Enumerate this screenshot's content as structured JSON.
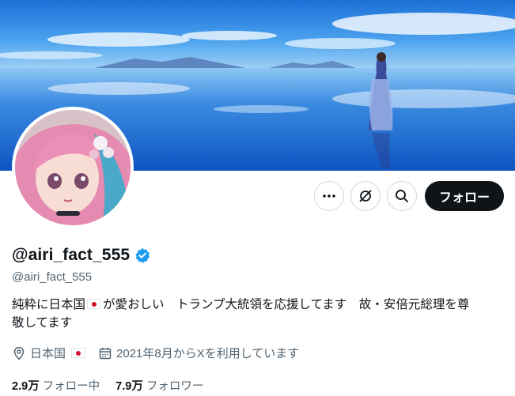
{
  "profile": {
    "display_name": "@airi_fact_555",
    "handle": "@airi_fact_555",
    "verified": true,
    "bio_line1_a": "純粋に日本国",
    "bio_line1_b": "が愛おしい　トランプ大統領を応援してます　故・安倍元総理を尊",
    "bio_line2": "敬してます",
    "location": "日本国",
    "joined": "2021年8月からXを利用しています",
    "following_count": "2.9万",
    "following_label": "フォロー中",
    "followers_count": "7.9万",
    "followers_label": "フォロワー"
  },
  "actions": {
    "more_icon": "more-icon",
    "grok_icon": "grok-icon",
    "search_icon": "search-icon",
    "follow_label": "フォロー"
  },
  "colors": {
    "verified_badge": "#1d9bf0",
    "follow_button": "#0f1419",
    "secondary_text": "#536471",
    "flag_red": "#d0102c"
  }
}
